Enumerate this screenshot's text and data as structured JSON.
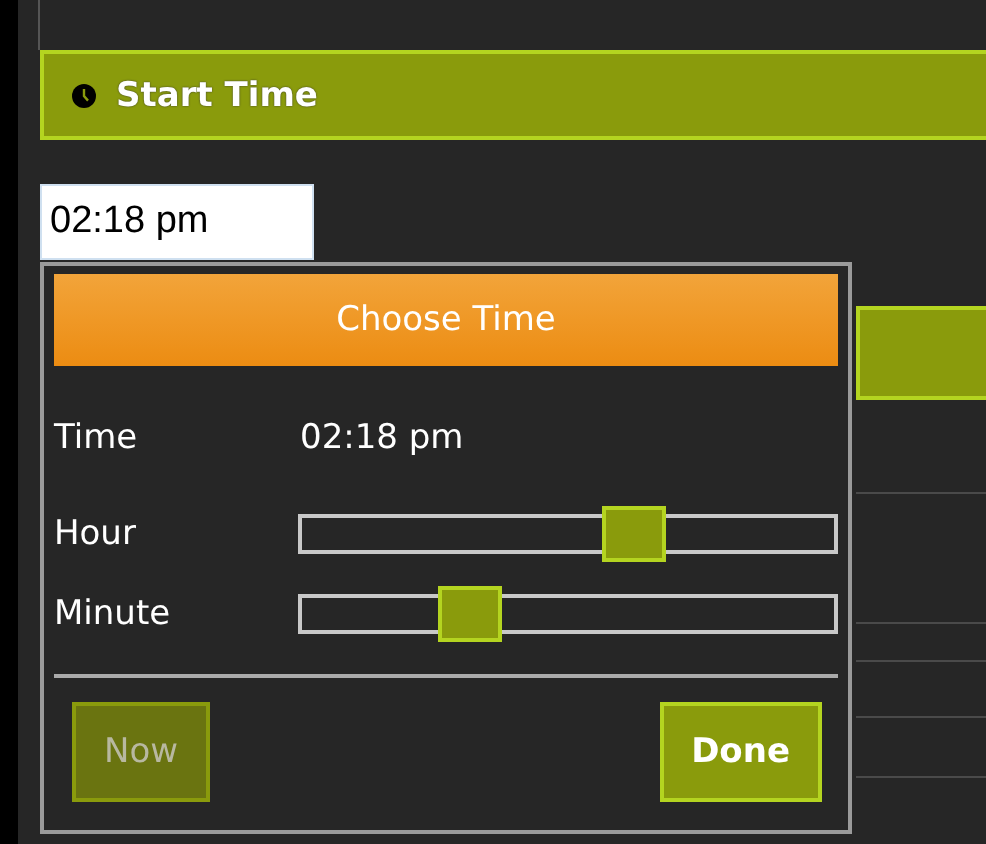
{
  "section": {
    "title": "Start Time"
  },
  "time_field": {
    "value": "02:18 pm"
  },
  "picker": {
    "title": "Choose Time",
    "time_row": {
      "label": "Time",
      "value": "02:18 pm"
    },
    "sliders": [
      {
        "label": "Hour",
        "level": 0.64
      },
      {
        "label": "Minute",
        "level": 0.29
      }
    ],
    "buttons": [
      {
        "label": "Now",
        "disabled": true
      },
      {
        "label": "Done",
        "disabled": false
      }
    ]
  }
}
